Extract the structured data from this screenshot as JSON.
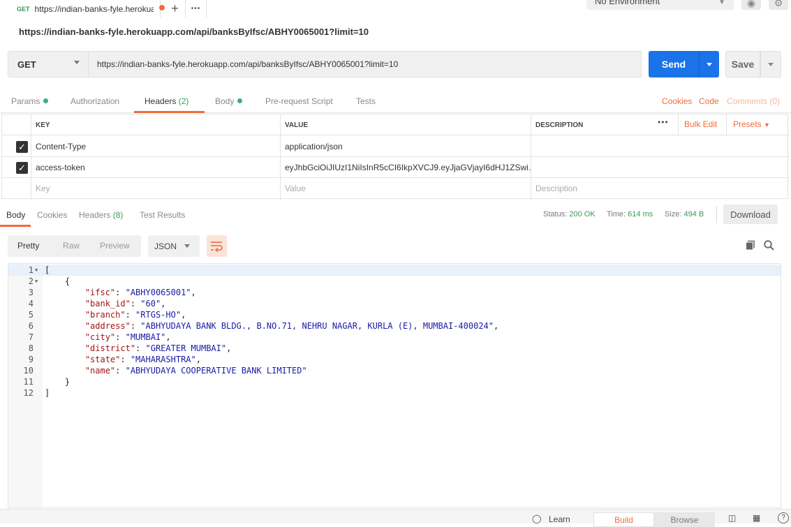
{
  "tabstrip": {
    "tab_method": "GET",
    "tab_title": "https://indian-banks-fyle.herokuapp.com",
    "add_label": "+",
    "more_label": "•••",
    "environment": "No Environment"
  },
  "request": {
    "title": "https://indian-banks-fyle.herokuapp.com/api/banksByIfsc/ABHY0065001?limit=10",
    "method": "GET",
    "url": "https://indian-banks-fyle.herokuapp.com/api/banksByIfsc/ABHY0065001?limit=10",
    "send_label": "Send",
    "save_label": "Save"
  },
  "request_tabs": {
    "params": "Params",
    "authorization": "Authorization",
    "headers": "Headers",
    "headers_count": "(2)",
    "body": "Body",
    "prerequest": "Pre-request Script",
    "tests": "Tests",
    "cookies": "Cookies",
    "code": "Code",
    "comments": "Comments (0)"
  },
  "headers_table": {
    "col_key": "KEY",
    "col_value": "VALUE",
    "col_description": "DESCRIPTION",
    "more": "•••",
    "bulk_edit": "Bulk Edit",
    "presets": "Presets",
    "rows": [
      {
        "key": "Content-Type",
        "value": "application/json",
        "description": ""
      },
      {
        "key": "access-token",
        "value": "eyJhbGciOiJIUzI1NiIsInR5cCI6IkpXVCJ9.eyJjaGVjayI6dHJ1ZSwi…",
        "description": ""
      }
    ],
    "placeholder_key": "Key",
    "placeholder_value": "Value",
    "placeholder_description": "Description"
  },
  "response_tabs": {
    "body": "Body",
    "cookies": "Cookies",
    "headers": "Headers",
    "headers_count": "(8)",
    "test_results": "Test Results",
    "status_label": "Status:",
    "status_value": "200 OK",
    "time_label": "Time:",
    "time_value": "614 ms",
    "size_label": "Size:",
    "size_value": "494 B",
    "download": "Download"
  },
  "response_toolbar": {
    "pretty": "Pretty",
    "raw": "Raw",
    "preview": "Preview",
    "format": "JSON"
  },
  "response_body": [
    {
      "n": "1",
      "fold": true,
      "parts": [
        [
          "p",
          "["
        ]
      ]
    },
    {
      "n": "2",
      "fold": true,
      "parts": [
        [
          "p",
          "    {"
        ]
      ]
    },
    {
      "n": "3",
      "fold": false,
      "parts": [
        [
          "p",
          "        "
        ],
        [
          "k",
          "\"ifsc\""
        ],
        [
          "p",
          ": "
        ],
        [
          "s",
          "\"ABHY0065001\""
        ],
        [
          "p",
          ","
        ]
      ]
    },
    {
      "n": "4",
      "fold": false,
      "parts": [
        [
          "p",
          "        "
        ],
        [
          "k",
          "\"bank_id\""
        ],
        [
          "p",
          ": "
        ],
        [
          "s",
          "\"60\""
        ],
        [
          "p",
          ","
        ]
      ]
    },
    {
      "n": "5",
      "fold": false,
      "parts": [
        [
          "p",
          "        "
        ],
        [
          "k",
          "\"branch\""
        ],
        [
          "p",
          ": "
        ],
        [
          "s",
          "\"RTGS-HO\""
        ],
        [
          "p",
          ","
        ]
      ]
    },
    {
      "n": "6",
      "fold": false,
      "parts": [
        [
          "p",
          "        "
        ],
        [
          "k",
          "\"address\""
        ],
        [
          "p",
          ": "
        ],
        [
          "s",
          "\"ABHYUDAYA BANK BLDG., B.NO.71, NEHRU NAGAR, KURLA (E), MUMBAI-400024\""
        ],
        [
          "p",
          ","
        ]
      ]
    },
    {
      "n": "7",
      "fold": false,
      "parts": [
        [
          "p",
          "        "
        ],
        [
          "k",
          "\"city\""
        ],
        [
          "p",
          ": "
        ],
        [
          "s",
          "\"MUMBAI\""
        ],
        [
          "p",
          ","
        ]
      ]
    },
    {
      "n": "8",
      "fold": false,
      "parts": [
        [
          "p",
          "        "
        ],
        [
          "k",
          "\"district\""
        ],
        [
          "p",
          ": "
        ],
        [
          "s",
          "\"GREATER MUMBAI\""
        ],
        [
          "p",
          ","
        ]
      ]
    },
    {
      "n": "9",
      "fold": false,
      "parts": [
        [
          "p",
          "        "
        ],
        [
          "k",
          "\"state\""
        ],
        [
          "p",
          ": "
        ],
        [
          "s",
          "\"MAHARASHTRA\""
        ],
        [
          "p",
          ","
        ]
      ]
    },
    {
      "n": "10",
      "fold": false,
      "parts": [
        [
          "p",
          "        "
        ],
        [
          "k",
          "\"name\""
        ],
        [
          "p",
          ": "
        ],
        [
          "s",
          "\"ABHYUDAYA COOPERATIVE BANK LIMITED\""
        ]
      ]
    },
    {
      "n": "11",
      "fold": false,
      "parts": [
        [
          "p",
          "    }"
        ]
      ]
    },
    {
      "n": "12",
      "fold": false,
      "parts": [
        [
          "p",
          "]"
        ]
      ]
    }
  ],
  "bottombar": {
    "learn": "Learn",
    "build": "Build",
    "browse": "Browse",
    "help": "?"
  },
  "colors": {
    "accent": "#f26b3a",
    "send": "#1a73e8",
    "status_green": "#3a9a5a",
    "json_key": "#a31515",
    "json_string": "#1a1aa6"
  }
}
